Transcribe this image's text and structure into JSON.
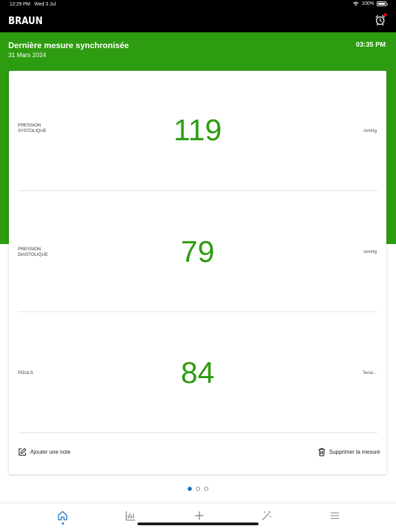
{
  "status_bar": {
    "time": "12:29 PM",
    "date": "Wed 3 Jul",
    "battery": "100%"
  },
  "header": {
    "logo": "BRAUN",
    "alarm_icon": "alarm-clock-icon"
  },
  "measurement": {
    "title": "Dernière mesure synchronisée",
    "date": "31 Mars 2024",
    "time": "03:35 PM"
  },
  "readings": [
    {
      "label_line1": "PRESSION",
      "label_line2": "SYSTOLIQUE",
      "value": "119",
      "unit": "mmHg"
    },
    {
      "label_line1": "PRESSION",
      "label_line2": "DIASTOLIQUE",
      "value": "79",
      "unit": "mmHg"
    },
    {
      "label_line1": "POULS",
      "label_line2": "",
      "value": "84",
      "unit": "Tensi..."
    }
  ],
  "actions": {
    "add_note": "Ajouter une note",
    "delete": "Supprimer la mesure"
  },
  "pager": {
    "count": 3,
    "active": 0
  },
  "colors": {
    "brand_green": "#2d9c10",
    "active_blue": "#1a6fc2",
    "alert_red": "#e2001a"
  },
  "tabbar": {
    "items": [
      "home-icon",
      "chart-icon",
      "plus-icon",
      "magic-wand-icon",
      "menu-icon"
    ],
    "active": "home-icon"
  }
}
